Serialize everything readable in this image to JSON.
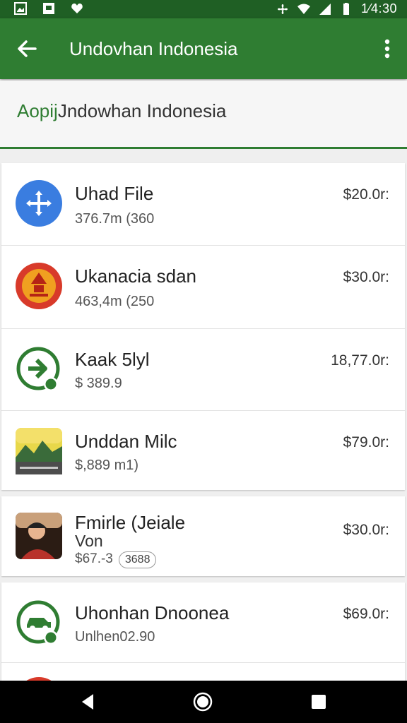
{
  "status_bar": {
    "time": "1⁄4:30",
    "icons": [
      "image-icon",
      "notification-icon",
      "heart-icon",
      "fan-icon",
      "wifi-icon",
      "signal-icon",
      "battery-icon"
    ]
  },
  "app_bar": {
    "title": "Undovhan Indonesia"
  },
  "header": {
    "accent": "Aopij",
    "text": "Jndowhan Indonesia"
  },
  "items": [
    {
      "title": "Uhad  File",
      "subtitle": "376.7m (360",
      "price": "$20.0r:",
      "icon": "crosshair-icon"
    },
    {
      "title": "Ukanacia sdan",
      "subtitle": "463,4m (250",
      "price": "$30.0r:",
      "icon": "pagoda-icon"
    },
    {
      "title": "Kaak 5lyl",
      "subtitle": "$ 389.9",
      "price": "18,77.0r:",
      "icon": "arrow-circle-icon"
    },
    {
      "title": "Unddan Milc",
      "subtitle": "$,889 m1)",
      "price": "$79.0r:",
      "icon": "landscape-icon"
    },
    {
      "title": "Fmirle (Jeiale",
      "subtitle2": "Von",
      "subtitle": "$67.-3",
      "badge": "3688",
      "price": "$30.0r:",
      "icon": "person-photo-icon"
    },
    {
      "title": "Uhonhan Dnoonea",
      "subtitle": "Unlhen02.90",
      "price": "$69.0r:",
      "icon": "car-circle-icon"
    }
  ],
  "colors": {
    "primary": "#2f7d32",
    "status_bar": "#1f5f24"
  }
}
